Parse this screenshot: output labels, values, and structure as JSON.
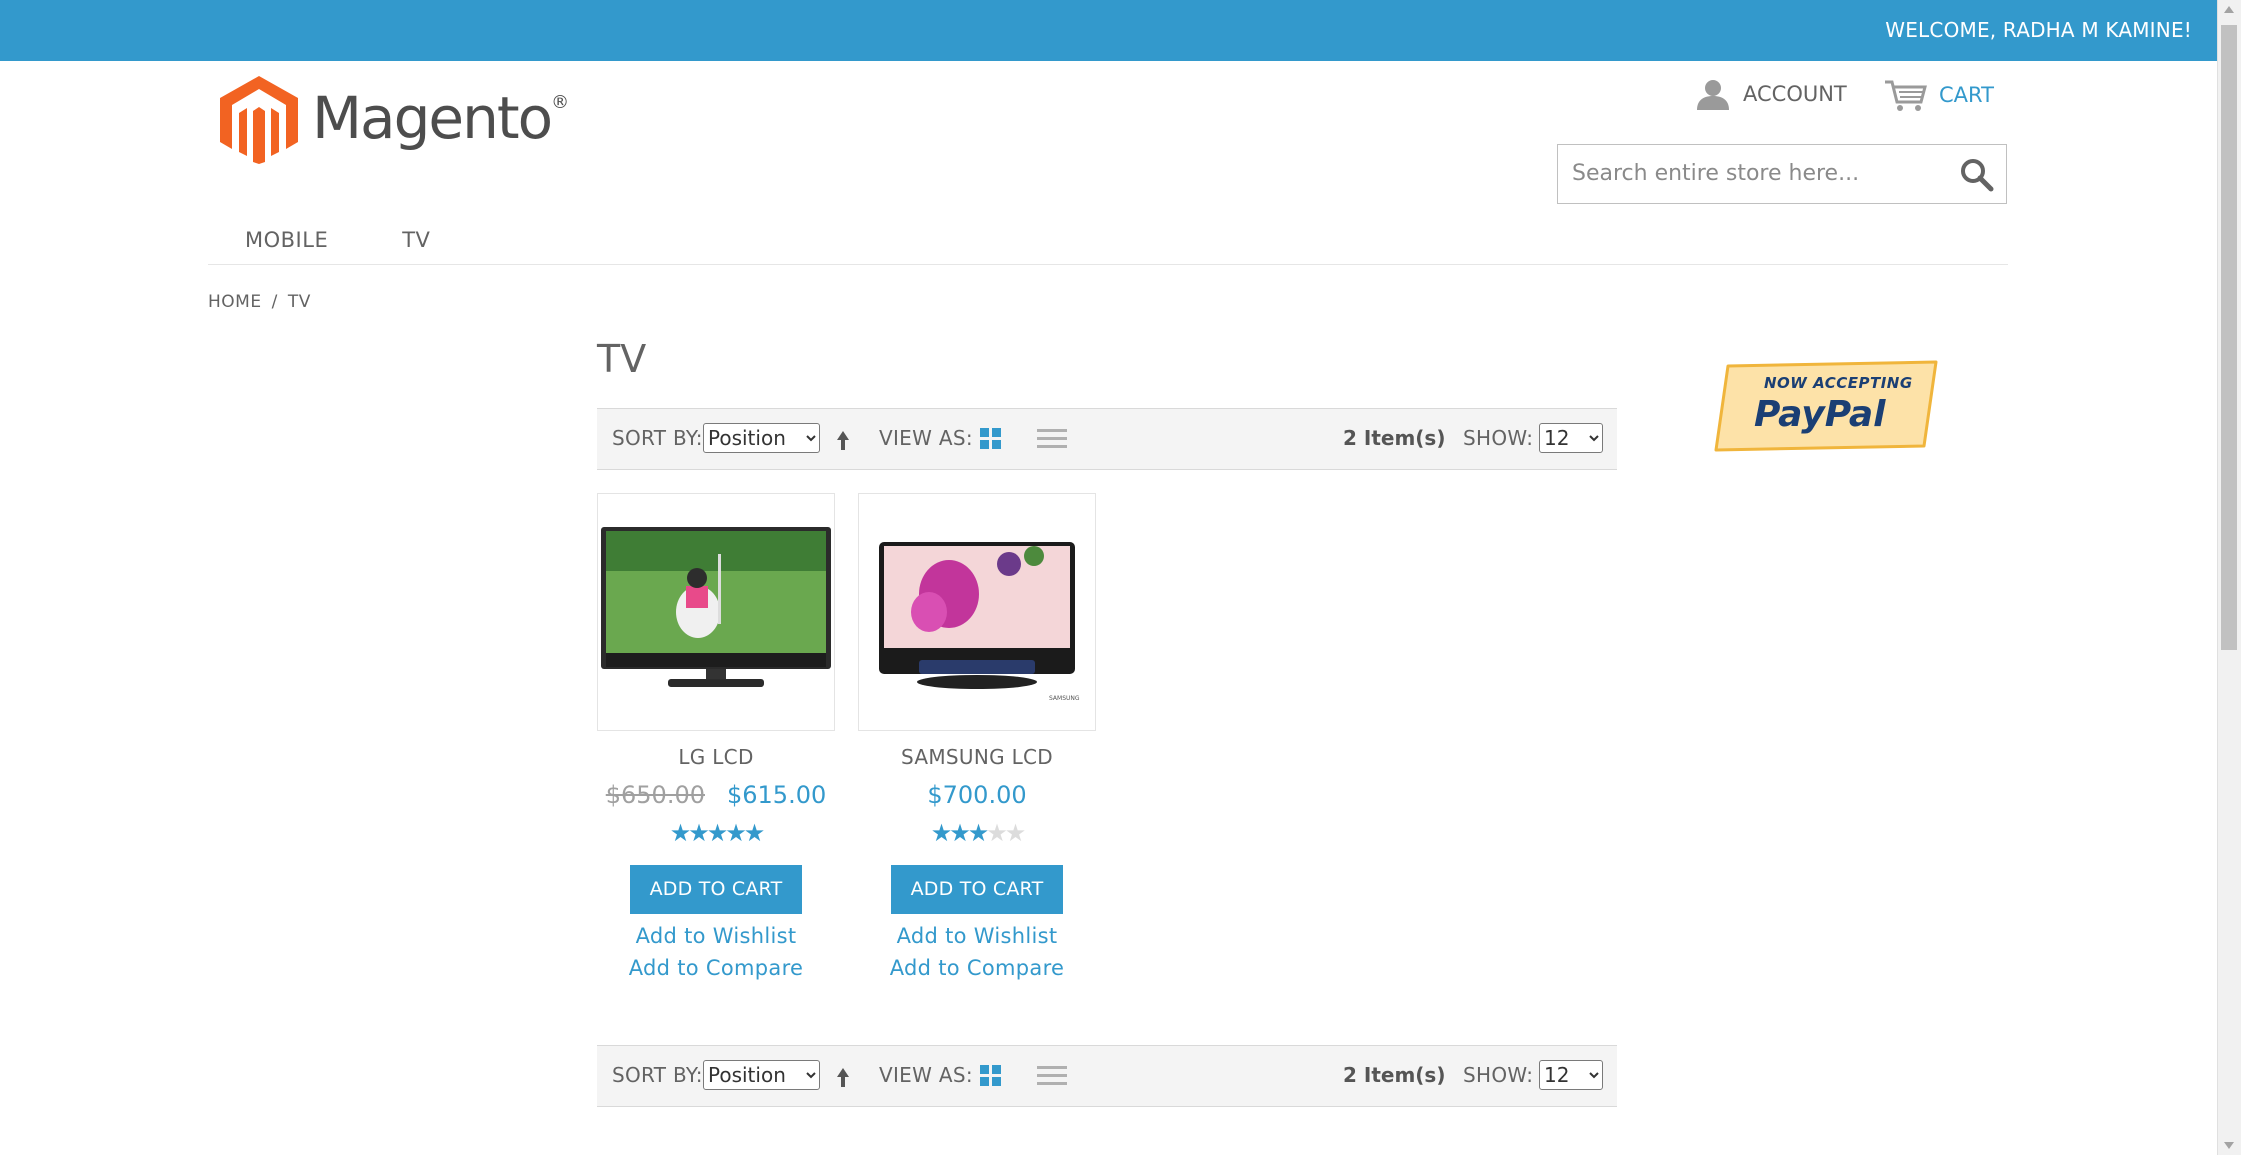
{
  "header": {
    "welcome": "WELCOME, RADHA M KAMINE!",
    "logo_text": "Magento",
    "logo_mark": "®",
    "account_label": "ACCOUNT",
    "cart_label": "CART",
    "search_placeholder": "Search entire store here..."
  },
  "nav": {
    "items": [
      "MOBILE",
      "TV"
    ]
  },
  "breadcrumb": {
    "home": "HOME",
    "separator": "/",
    "current": "TV"
  },
  "page": {
    "title": "TV"
  },
  "toolbar": {
    "sort_label": "SORT BY:",
    "sort_value": "Position",
    "view_label": "VIEW AS:",
    "item_count": "2 Item(s)",
    "show_label": "SHOW:",
    "show_value": "12"
  },
  "sidebar": {
    "paypal_top": "NOW ACCEPTING",
    "paypal_brand": "PayPal"
  },
  "products": [
    {
      "name": "LG LCD",
      "old_price": "$650.00",
      "price": "$615.00",
      "rating": 5,
      "add_to_cart": "ADD TO CART",
      "wishlist": "Add to Wishlist",
      "compare": "Add to Compare"
    },
    {
      "name": "SAMSUNG LCD",
      "price": "$700.00",
      "rating": 3,
      "add_to_cart": "ADD TO CART",
      "wishlist": "Add to Wishlist",
      "compare": "Add to Compare"
    }
  ],
  "colors": {
    "accent": "#3399cc",
    "text": "#636363",
    "logo_orange": "#f26322"
  }
}
